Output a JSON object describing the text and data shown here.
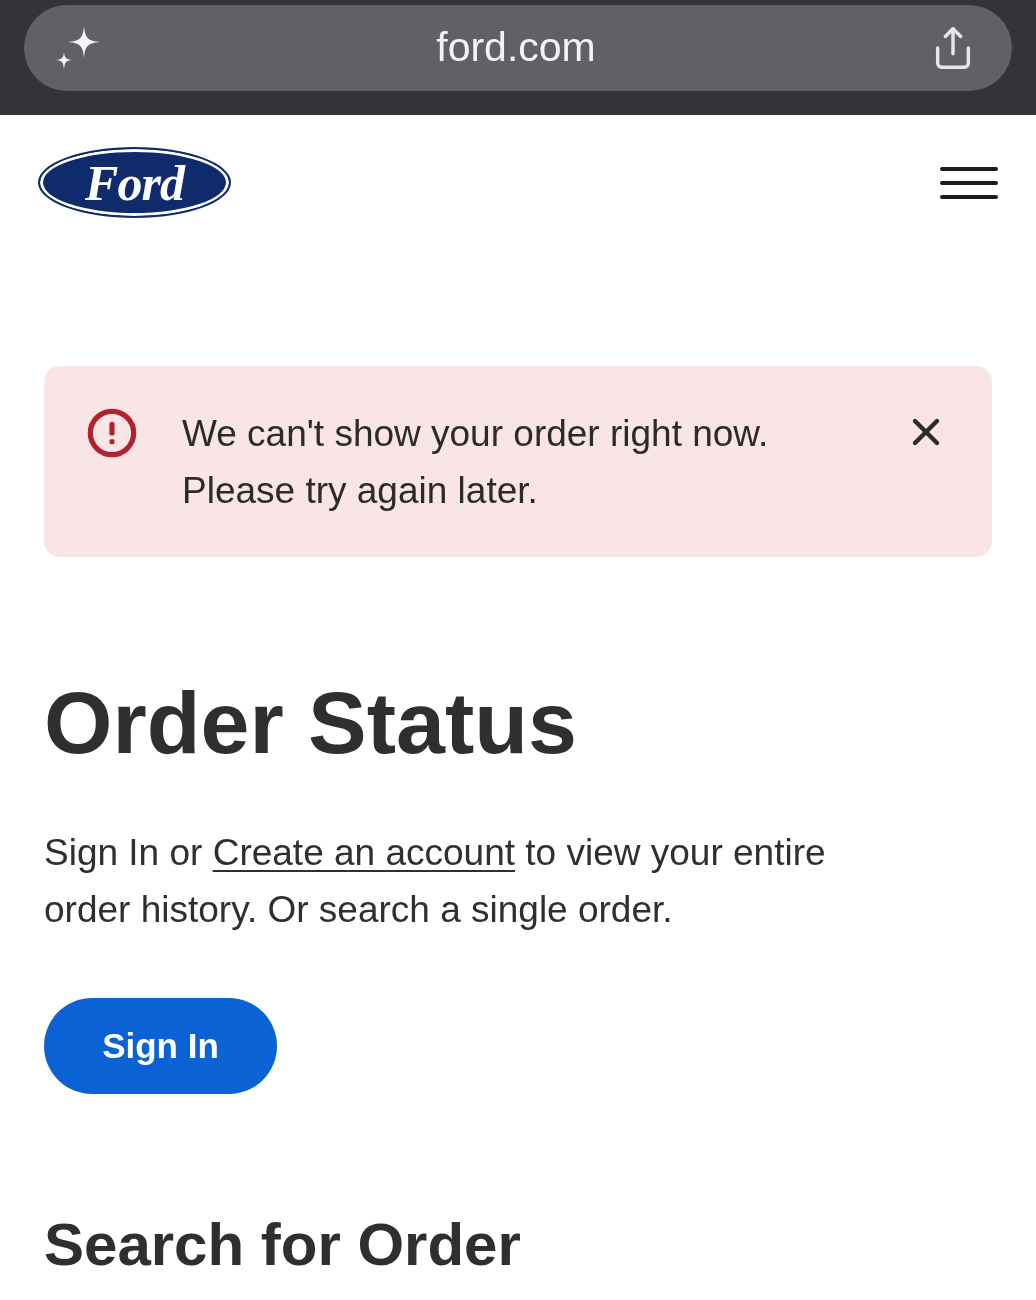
{
  "browser": {
    "address": "ford.com"
  },
  "header": {
    "logo_text": "Ford"
  },
  "alert": {
    "kind": "error",
    "message": "We can't show your order right now. Please try again later."
  },
  "page": {
    "title": "Order Status",
    "intro": {
      "before": "Sign In or ",
      "link": "Create an account",
      "after": " to view your entire order history. Or search a single order."
    },
    "sign_in_button": "Sign In",
    "section_title": "Search for Order"
  }
}
